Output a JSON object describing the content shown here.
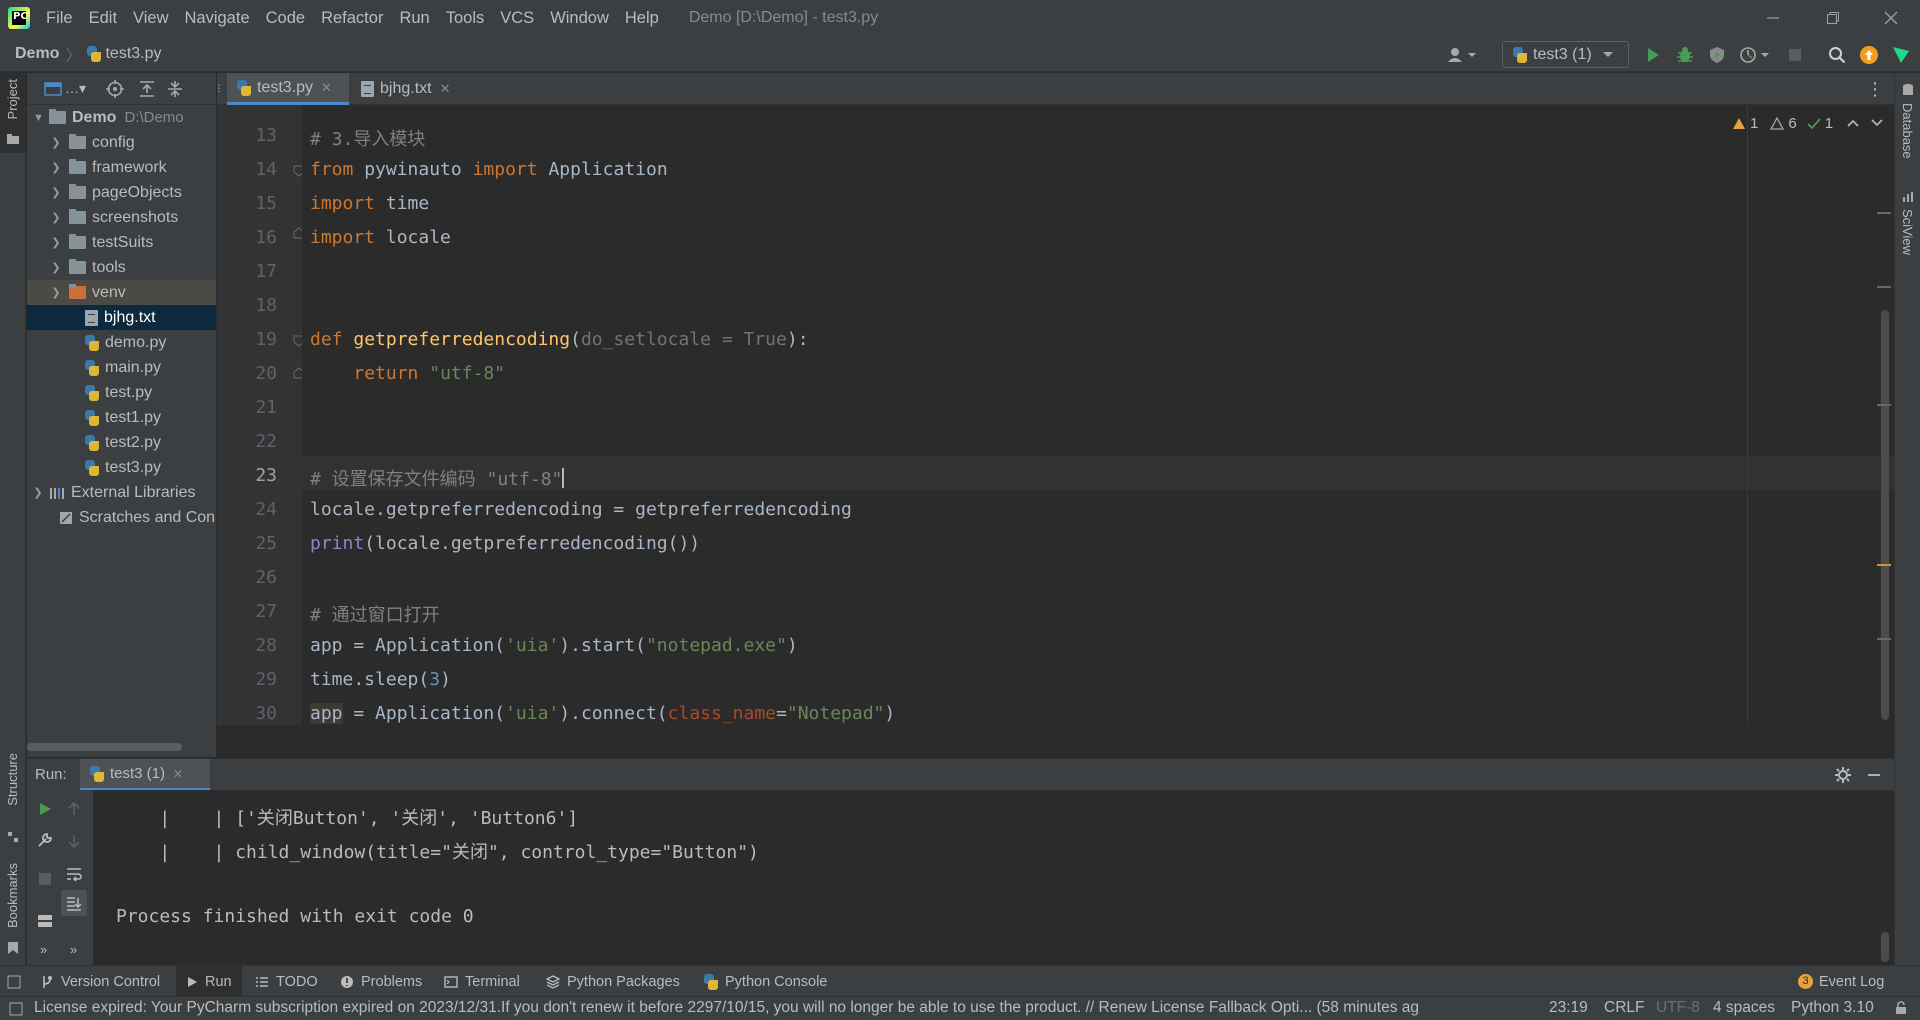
{
  "app": {
    "menus": [
      "File",
      "Edit",
      "View",
      "Navigate",
      "Code",
      "Refactor",
      "Run",
      "Tools",
      "VCS",
      "Window",
      "Help"
    ],
    "window_title": "Demo [D:\\Demo] - test3.py"
  },
  "navbar": {
    "project": "Demo",
    "file": "test3.py",
    "run_config": "test3 (1)"
  },
  "sidebars": {
    "left_top": "Project",
    "left_structure": "Structure",
    "left_bookmarks": "Bookmarks",
    "right_database": "Database",
    "right_sciview": "SciView"
  },
  "project_tree": {
    "root_name": "Demo",
    "root_path": "D:\\Demo",
    "folders": [
      "config",
      "framework",
      "pageObjects",
      "screenshots",
      "testSuits",
      "tools"
    ],
    "venv": "venv",
    "files": [
      "bjhg.txt",
      "demo.py",
      "main.py",
      "test.py",
      "test1.py",
      "test2.py",
      "test3.py"
    ],
    "external": "External Libraries",
    "scratches": "Scratches and Con"
  },
  "editor": {
    "tabs": [
      "test3.py",
      "bjhg.txt"
    ],
    "inspections": {
      "warnings": "1",
      "weak_warnings": "6",
      "typos": "1"
    },
    "line_numbers": [
      "13",
      "14",
      "15",
      "16",
      "17",
      "18",
      "19",
      "20",
      "21",
      "22",
      "23",
      "24",
      "25",
      "26",
      "27",
      "28",
      "29",
      "30"
    ],
    "current_line": "23"
  },
  "run_panel": {
    "label": "Run:",
    "tab": "test3 (1)",
    "output": [
      "    |    | ['关闭Button', '关闭', 'Button6']",
      "    |    | child_window(title=\"关闭\", control_type=\"Button\")",
      "",
      "Process finished with exit code 0"
    ]
  },
  "bottom_tools": [
    "Version Control",
    "Run",
    "TODO",
    "Problems",
    "Terminal",
    "Python Packages",
    "Python Console"
  ],
  "event_log": {
    "label": "Event Log",
    "count": "3"
  },
  "status": {
    "message": "License expired: Your PyCharm subscription expired on 2023/12/31.If you don't renew it before 2297/10/15, you will no longer be able to use the product. // Renew License   Fallback Opti... (58 minutes ag",
    "position": "23:19",
    "line_sep": "CRLF",
    "encoding": "UTF-8",
    "indent": "4 spaces",
    "interpreter": "Python 3.10"
  },
  "colors": {
    "keyword": "#cc7832",
    "function": "#ffc66d",
    "string": "#6a8759",
    "comment": "#808080",
    "number": "#6897bb",
    "accent": "#4a88c7"
  }
}
